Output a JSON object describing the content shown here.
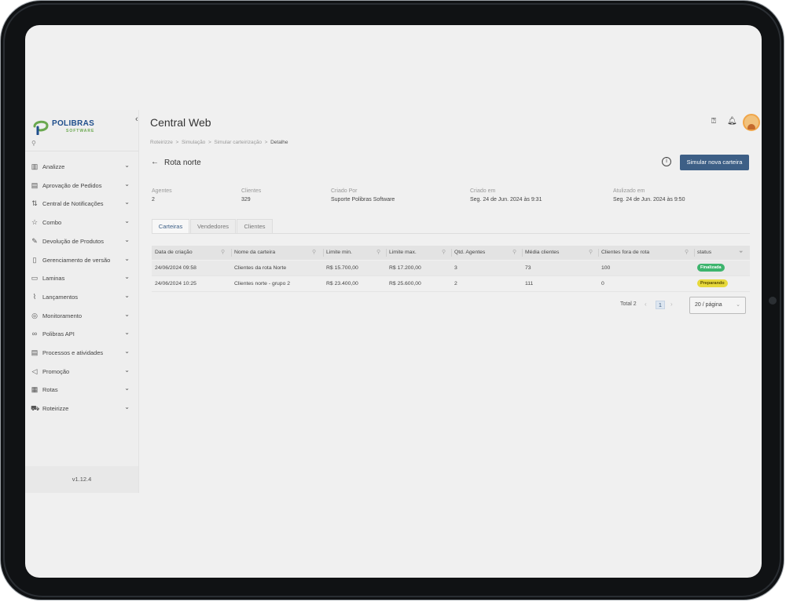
{
  "app": {
    "logo": "POLIBRAS",
    "logo_sub": "SOFTWARE",
    "title": "Central Web",
    "version": "v1.12.4"
  },
  "sidebar": {
    "items": [
      {
        "label": "Analizze",
        "icon": "bar-chart-icon"
      },
      {
        "label": "Aprovação de Pedidos",
        "icon": "document-check-icon"
      },
      {
        "label": "Central de Notificações",
        "icon": "sync-icon"
      },
      {
        "label": "Combo",
        "icon": "star-icon"
      },
      {
        "label": "Devolução de Produtos",
        "icon": "edit-document-icon"
      },
      {
        "label": "Gerenciamento de versão",
        "icon": "file-icon"
      },
      {
        "label": "Laminas",
        "icon": "book-icon"
      },
      {
        "label": "Lançamentos",
        "icon": "trend-icon"
      },
      {
        "label": "Monitoramento",
        "icon": "target-icon"
      },
      {
        "label": "Polibras API",
        "icon": "link-icon"
      },
      {
        "label": "Processos e atividades",
        "icon": "clipboard-icon"
      },
      {
        "label": "Promoção",
        "icon": "megaphone-icon"
      },
      {
        "label": "Rotas",
        "icon": "calendar-icon"
      },
      {
        "label": "Roteirizze",
        "icon": "truck-icon"
      }
    ]
  },
  "breadcrumb": {
    "items": [
      "Roteirizze",
      "Simulação",
      "Simular carteirização"
    ],
    "separator": ">",
    "current": "Detalhe"
  },
  "detail": {
    "title": "Rota norte",
    "primary_button": "Simular nova carteira",
    "meta": [
      {
        "label": "Agentes",
        "value": "2"
      },
      {
        "label": "Clientes",
        "value": "329"
      },
      {
        "label": "Criado Por",
        "value": "Suporte Polibras Software"
      },
      {
        "label": "Criado em",
        "value": "Seg. 24 de Jun. 2024 às 9:31"
      },
      {
        "label": "Atulizado em",
        "value": "Seg. 24 de Jun. 2024 às 9:50"
      }
    ]
  },
  "tabs": [
    "Carteiras",
    "Vendedores",
    "Clientes"
  ],
  "table": {
    "columns": [
      "Data de criação",
      "Nome da carteira",
      "Limite min.",
      "Limite max.",
      "Qtd. Agentes",
      "Média clientes",
      "Clientes fora de rota",
      "status"
    ],
    "rows": [
      {
        "data": "24/06/2024 09:58",
        "nome": "Clientes da rota Norte",
        "min": "R$ 15.700,00",
        "max": "R$ 17.200,00",
        "agentes": "3",
        "media": "73",
        "fora": "100",
        "status": "Finalizada",
        "status_color": "#3db46d"
      },
      {
        "data": "24/06/2024 10:25",
        "nome": "Clientes norte - grupo 2",
        "min": "R$ 23.400,00",
        "max": "R$ 25.600,00",
        "agentes": "2",
        "media": "111",
        "fora": "0",
        "status": "Preparando",
        "status_color": "#e6d83a"
      }
    ]
  },
  "pagination": {
    "total": "Total 2",
    "page": "1",
    "page_size": "20 / página"
  },
  "colors": {
    "primary": "#3d5f86",
    "status_done": "#3db46d",
    "status_preparing": "#e6d83a"
  }
}
